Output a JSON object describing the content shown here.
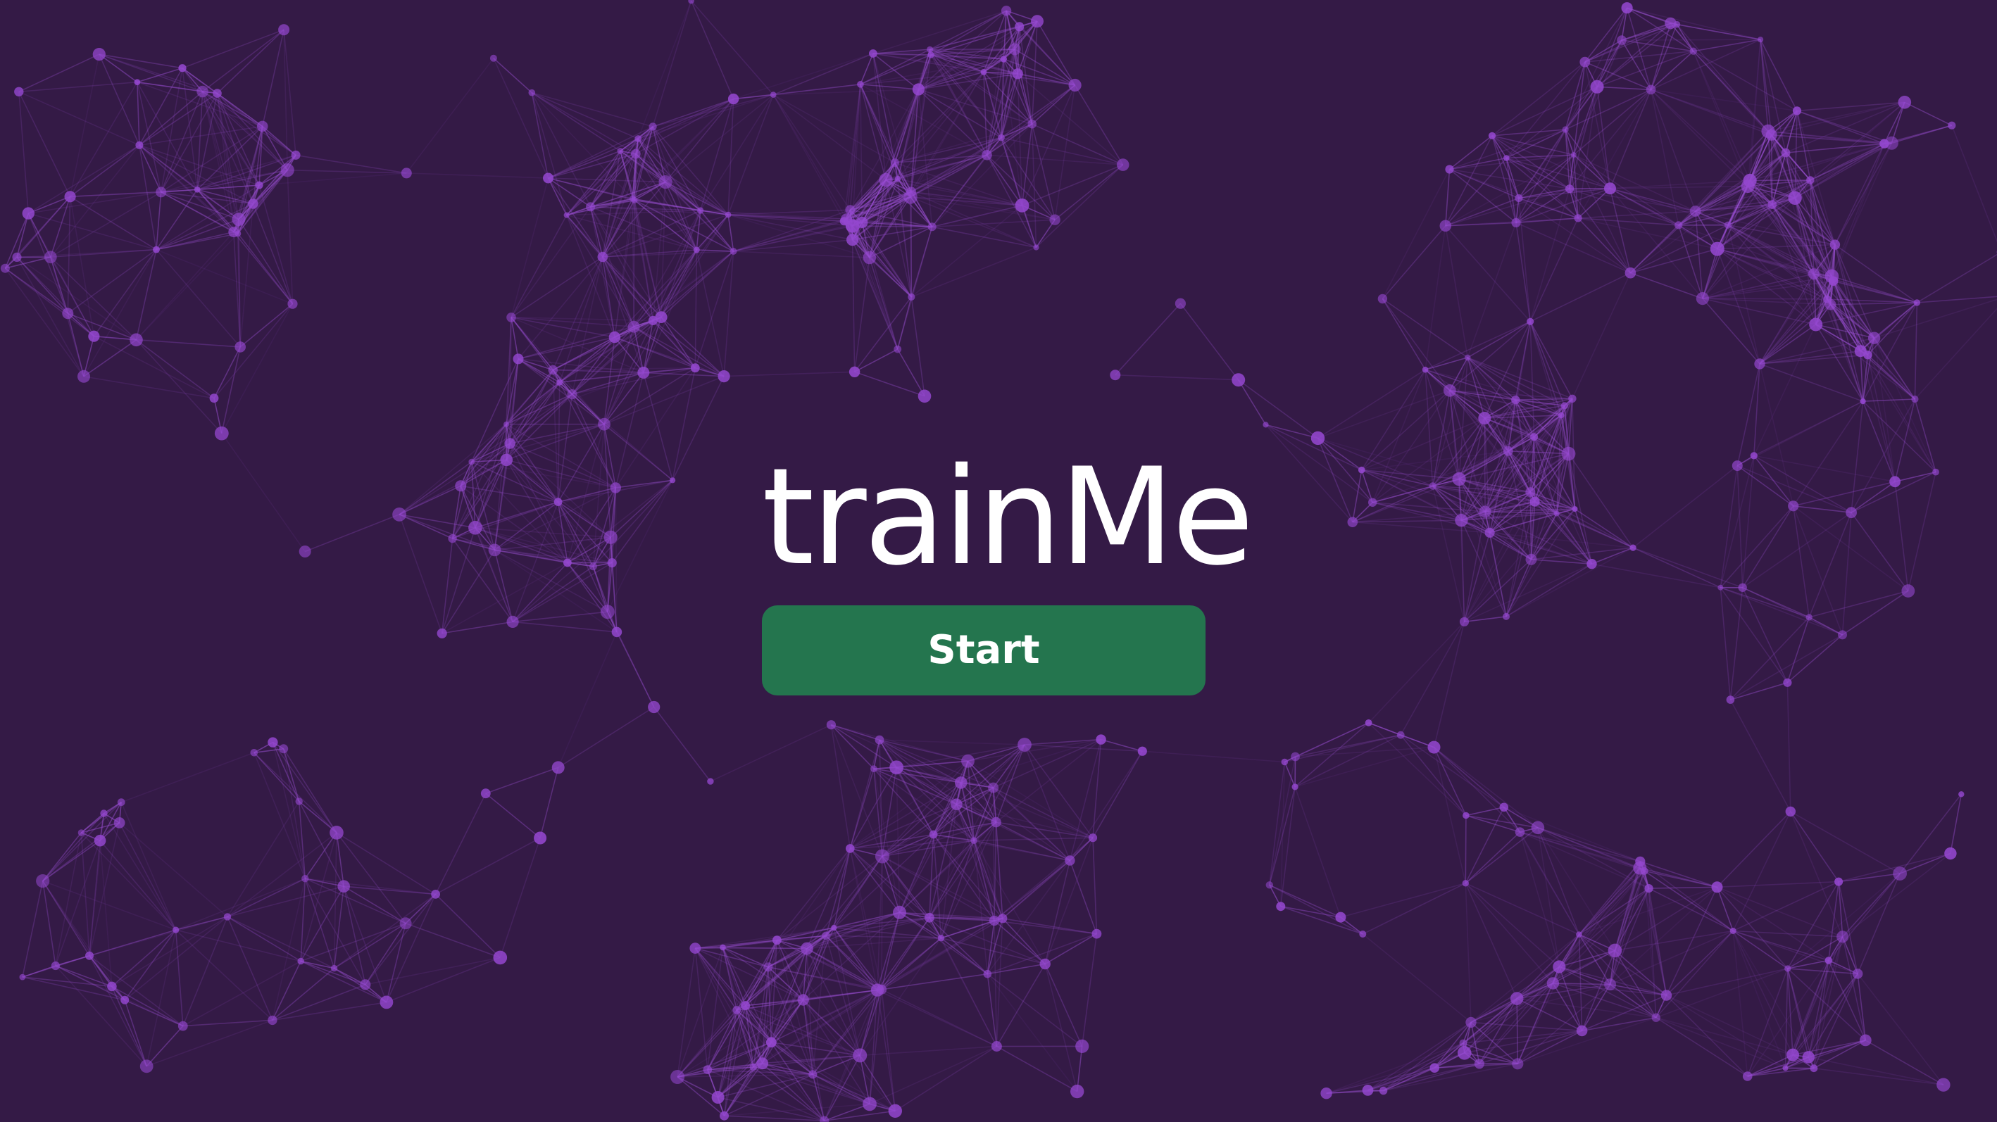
{
  "app": {
    "title": "trainMe"
  },
  "start_button": {
    "label": "Start"
  },
  "colors": {
    "background": "#341a46",
    "network_line": "#9b50d4",
    "network_node": "#9447cf",
    "button_bg": "#24754e",
    "text": "#ffffff"
  }
}
